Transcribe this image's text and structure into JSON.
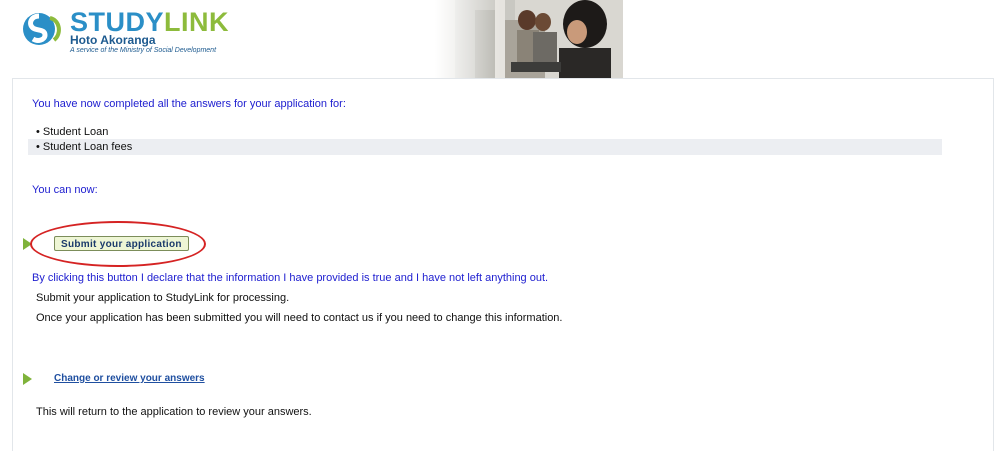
{
  "header": {
    "brand_part1": "STUDY",
    "brand_part2": "LINK",
    "subtitle": "Hoto Akoranga",
    "tagline": "A service of the Ministry of Social Development"
  },
  "main": {
    "completed_message": "You have now completed all the answers for your application for:",
    "applications": [
      {
        "label": "• Student Loan"
      },
      {
        "label": "• Student Loan fees"
      }
    ],
    "you_can_now": "You can now:",
    "submit_button": "Submit your application",
    "declaration": "By clicking this button I declare that the information I have provided is true and I have not left anything out.",
    "submit_info_1": "Submit your application to StudyLink for processing.",
    "submit_info_2": "Once your application has been submitted you will need to contact us if you need to change this information.",
    "change_link": "Change or review your answers",
    "change_info": "This will return to the application to review your answers."
  },
  "colors": {
    "message_blue": "#2020d0",
    "brand_blue": "#2b8fc7",
    "brand_green": "#8dbb3c",
    "arrow_green": "#7fb33b",
    "highlight_red": "#d52323"
  }
}
